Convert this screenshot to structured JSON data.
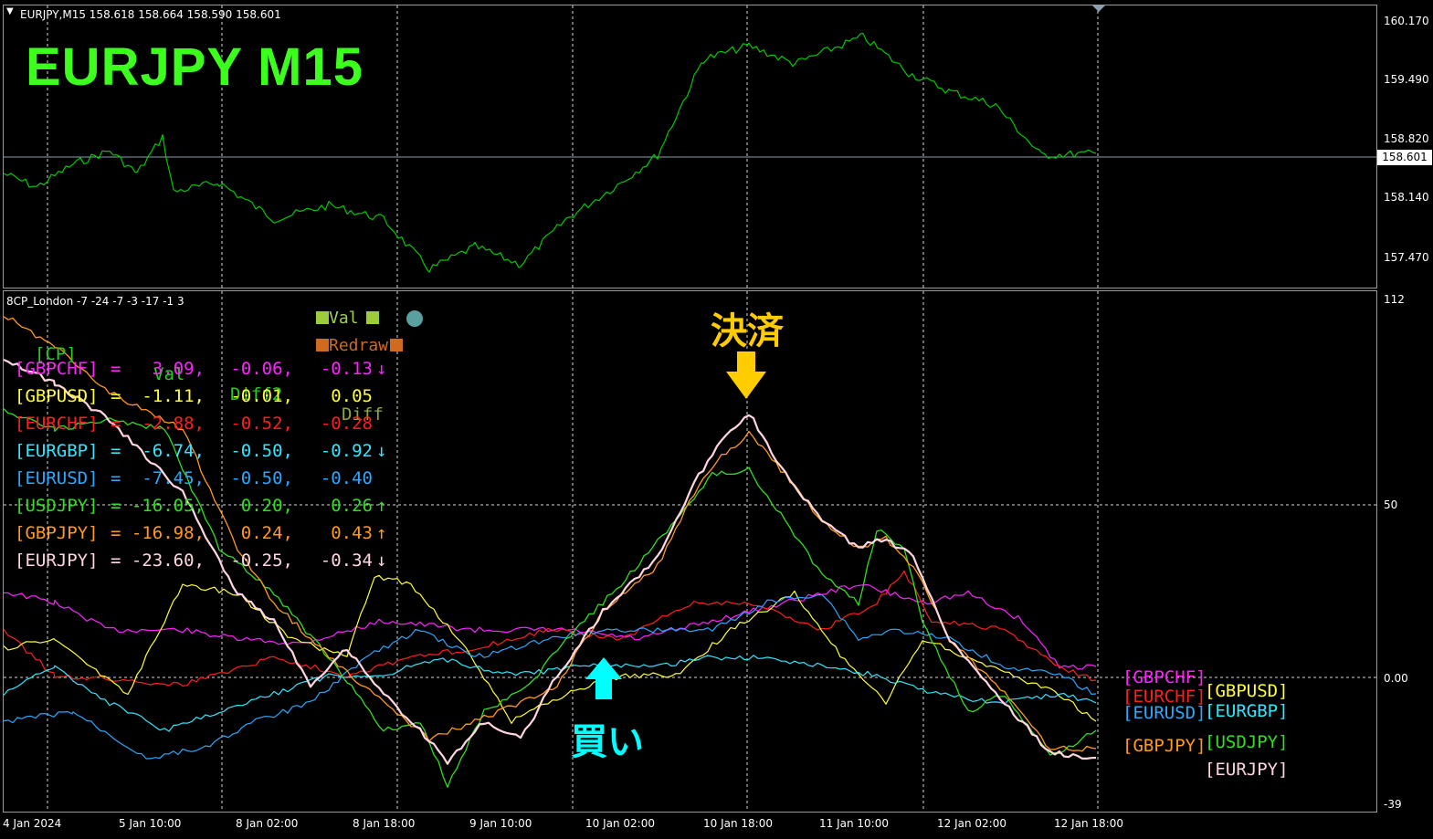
{
  "header": {
    "symbol_info": "EURJPY,M15  158.618 158.664 158.590 158.601",
    "indicator_info": "8CP_London -7 -24 -7 -3 -17 -1 3"
  },
  "title_overlay": "EURJPY  M15",
  "price_axis": {
    "labels": [
      "160.170",
      "159.490",
      "158.820",
      "158.140",
      "157.470"
    ],
    "current_price": "158.601"
  },
  "indicator_axis": {
    "labels": [
      "112",
      "50",
      "0.00",
      "-39"
    ]
  },
  "time_axis": {
    "labels": [
      "4 Jan 2024",
      "5 Jan 10:00",
      "8 Jan 02:00",
      "8 Jan 18:00",
      "9 Jan 10:00",
      "10 Jan 02:00",
      "10 Jan 18:00",
      "11 Jan 10:00",
      "12 Jan 02:00",
      "12 Jan 18:00"
    ]
  },
  "table": {
    "headers": {
      "cp": "[CP]",
      "val": "Val",
      "diff2": "Diff2",
      "diff": "Diff"
    },
    "rows": [
      {
        "pair": "[GBPCHF]",
        "eq": "=",
        "val": "3.09,",
        "diff2": "-0.06,",
        "diff": "-0.13",
        "arrow": "↓",
        "color": "#ff22ff"
      },
      {
        "pair": "[GBPUSD]",
        "eq": "=",
        "val": "-1.11,",
        "diff2": "-0.01,",
        "diff": "0.05",
        "arrow": "",
        "color": "#ffff33"
      },
      {
        "pair": "[EURCHF]",
        "eq": "=",
        "val": "-2.88,",
        "diff2": "-0.52,",
        "diff": "-0.28",
        "arrow": "",
        "color": "#ff1e1e"
      },
      {
        "pair": "[EURGBP]",
        "eq": "=",
        "val": "-6.74,",
        "diff2": "-0.50,",
        "diff": "-0.92",
        "arrow": "↓",
        "color": "#33e6ff"
      },
      {
        "pair": "[EURUSD]",
        "eq": "=",
        "val": "-7.45,",
        "diff2": "-0.50,",
        "diff": "-0.40",
        "arrow": "",
        "color": "#2aa8ff"
      },
      {
        "pair": "[USDJPY]",
        "eq": "=",
        "val": "-16.05,",
        "diff2": "0.20,",
        "diff": "0.26",
        "arrow": "↑",
        "color": "#33dd22"
      },
      {
        "pair": "[GBPJPY]",
        "eq": "=",
        "val": "-16.98,",
        "diff2": "0.24,",
        "diff": "0.43",
        "arrow": "↑",
        "color": "#ff9a1e"
      },
      {
        "pair": "[EURJPY]",
        "eq": "=",
        "val": "-23.60,",
        "diff2": "-0.25,",
        "diff": "-0.34",
        "arrow": "↓",
        "color": "#ffd6e0"
      }
    ]
  },
  "legend_buttons": {
    "val": "Val",
    "redraw": "Redraw"
  },
  "right_labels": {
    "gbpchf": "[GBPCHF]",
    "eurchf": "[EURCHF]",
    "gbpusd": "[GBPUSD]",
    "eurusd": "[EURUSD]",
    "eurgbp": "[EURGBP]",
    "gbpjpy": "[GBPJPY]",
    "usdjpy": "[USDJPY]",
    "eurjpy": "[EURJPY]"
  },
  "annotations": {
    "settle": "決済",
    "buy": "買い"
  },
  "colors": {
    "price_line": "#00c800",
    "grid": "#d8d8d8",
    "gbpchf": "#ff22ff",
    "gbpusd": "#ffff33",
    "eurchf": "#ff1e1e",
    "eurgbp": "#33e6ff",
    "eurusd": "#2aa8ff",
    "usdjpy": "#33dd22",
    "gbpjpy": "#ff9a1e",
    "eurjpy": "#ffd6e0",
    "annotation_settle": "#ffcc00",
    "annotation_buy": "#00ffff"
  }
}
